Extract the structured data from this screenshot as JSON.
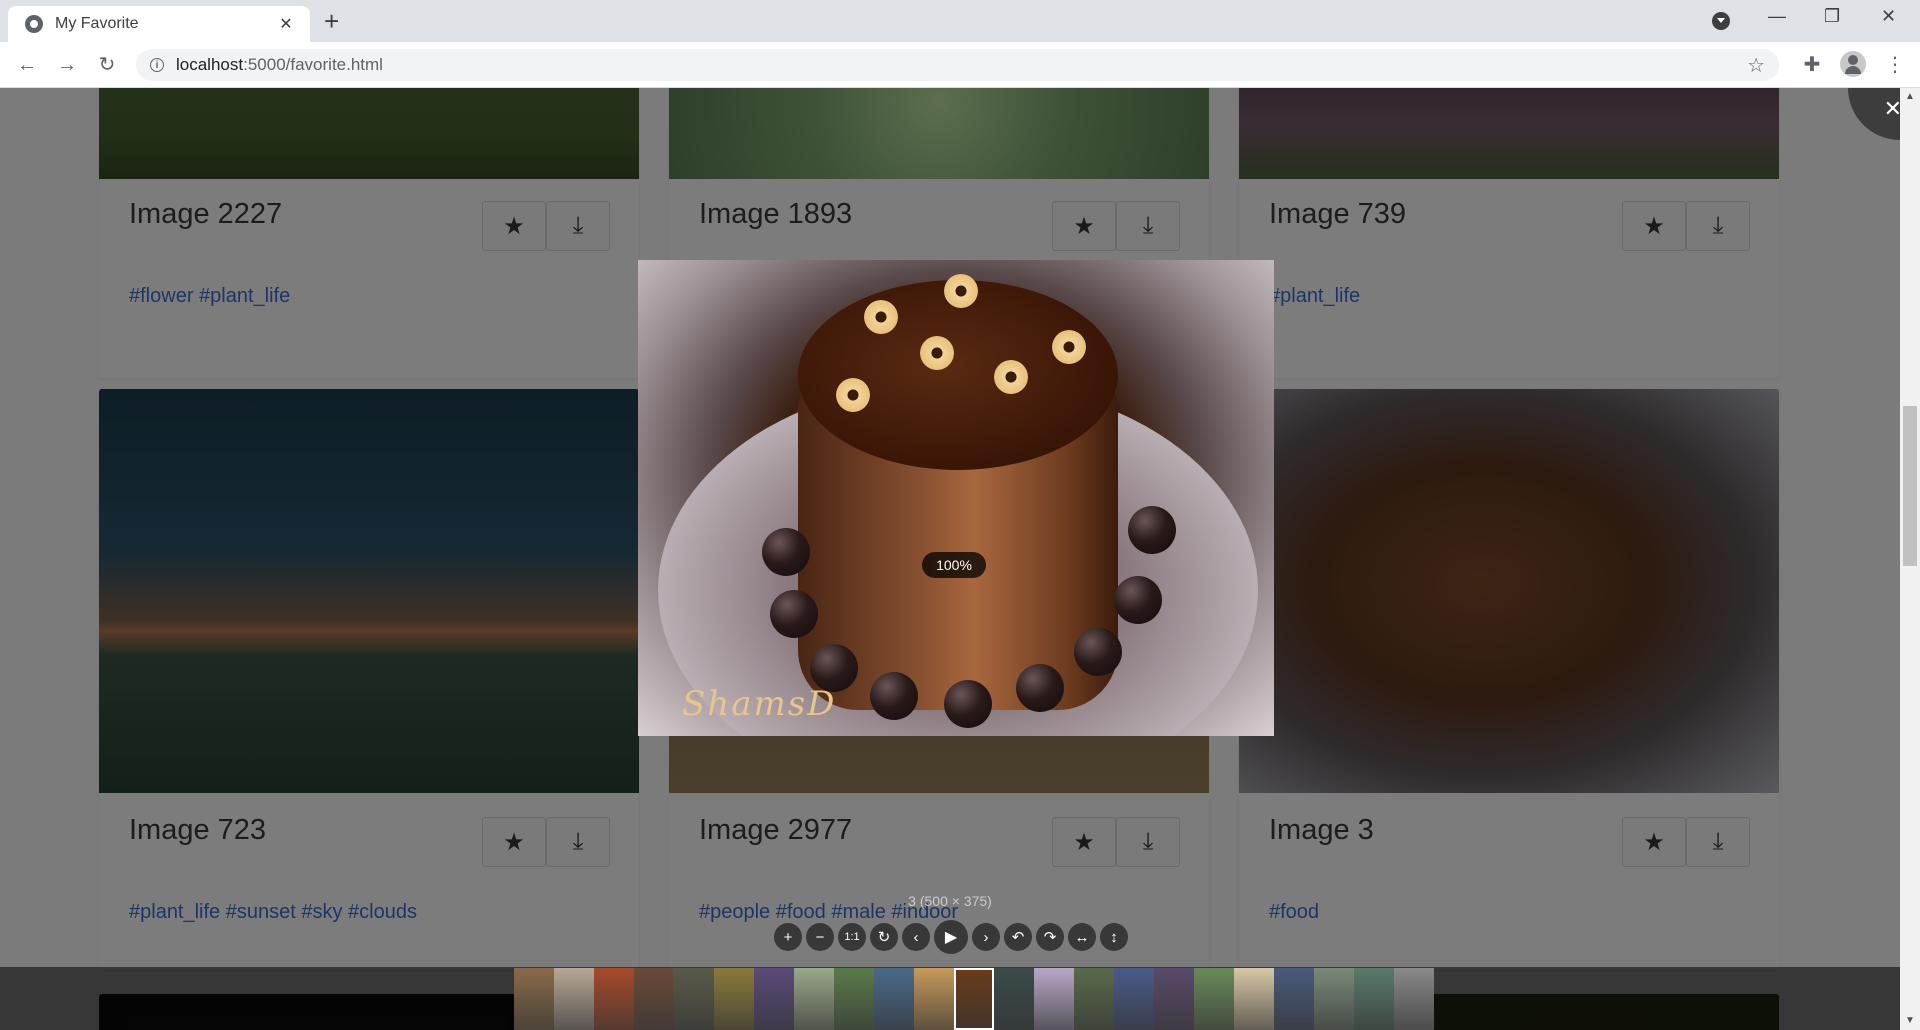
{
  "browser": {
    "tab_title": "My Favorite",
    "tab_close": "✕",
    "new_tab": "+",
    "url_host": "localhost",
    "url_path": ":5000/favorite.html",
    "minimize": "—",
    "maximize": "❐",
    "close": "✕",
    "back": "←",
    "forward": "→",
    "reload": "↻",
    "bookmark_star": "☆",
    "extensions": "✚",
    "menu": "⋮",
    "info": "i"
  },
  "cards": [
    {
      "title": "Image 2227",
      "tags": "#flower #plant_life"
    },
    {
      "title": "Image 1893",
      "tags": ""
    },
    {
      "title": "Image 739",
      "tags": "#plant_life"
    },
    {
      "title": "Image 723",
      "tags": "#plant_life #sunset #sky #clouds"
    },
    {
      "title": "Image 2977",
      "tags": "#people #food #male #indoor"
    },
    {
      "title": "Image 3",
      "tags": "#food"
    }
  ],
  "card_buttons": {
    "favorite": "★",
    "download": "⤓"
  },
  "viewer": {
    "close": "✕",
    "zoom": "100%",
    "caption": "3 (500 × 375)",
    "watermark": "ShamsD",
    "toolbar": {
      "zoom_in": "+",
      "zoom_out": "−",
      "one_to_one": "1:1",
      "reset": "↻",
      "prev": "‹",
      "play": "▶",
      "next": "›",
      "rotate_left": "↶",
      "rotate_right": "↷",
      "flip_h": "↔",
      "flip_v": "↕"
    },
    "thumbnail_colors": [
      "#8a6a4a",
      "#b8a898",
      "#a84a2a",
      "#6a4a3a",
      "#5a5a4a",
      "#8a7a3a",
      "#5a4a7a",
      "#9aa88a",
      "#5a7a4a",
      "#4a6a8a",
      "#c89a5a",
      "#6a3a1a",
      "#3a4a4a",
      "#b8a8c8",
      "#5a6a4a",
      "#4a5a8a",
      "#5a4a6a",
      "#6a8a5a",
      "#d8c8a8",
      "#4a5a7a",
      "#7a8a7a",
      "#5a7a6a",
      "#8a8a8a"
    ],
    "active_thumbnail_index": 11
  }
}
